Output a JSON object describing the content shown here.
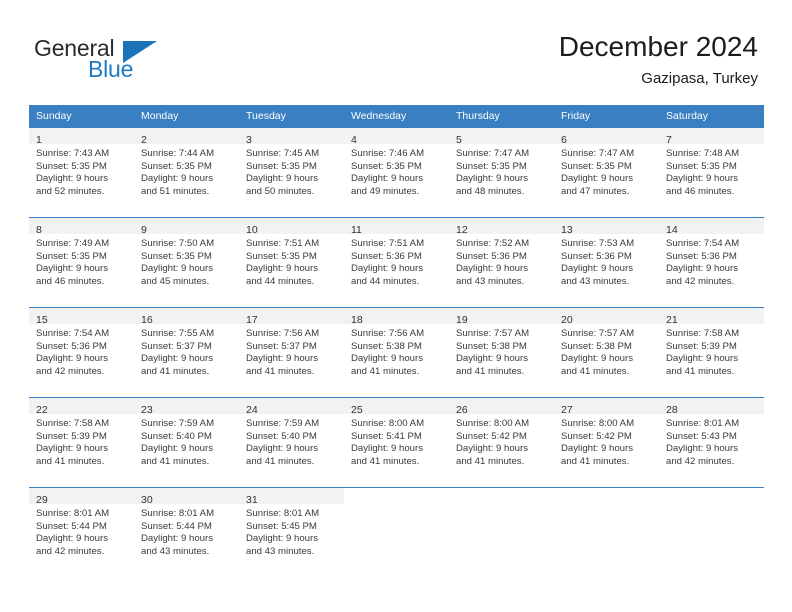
{
  "brand": {
    "name_top": "General",
    "name_bottom": "Blue",
    "triangle_icon": "triangle-icon",
    "accent_color": "#1a73b8"
  },
  "header": {
    "title": "December 2024",
    "subtitle": "Gazipasa, Turkey"
  },
  "theme": {
    "header_bg": "#3a7fc1",
    "daynum_band_bg": "#f2f2f2",
    "text_color": "#3a3a3a"
  },
  "weekdays": [
    "Sunday",
    "Monday",
    "Tuesday",
    "Wednesday",
    "Thursday",
    "Friday",
    "Saturday"
  ],
  "weeks": [
    [
      {
        "day": "1",
        "sunrise": "Sunrise: 7:43 AM",
        "sunset": "Sunset: 5:35 PM",
        "daylight_1": "Daylight: 9 hours",
        "daylight_2": "and 52 minutes."
      },
      {
        "day": "2",
        "sunrise": "Sunrise: 7:44 AM",
        "sunset": "Sunset: 5:35 PM",
        "daylight_1": "Daylight: 9 hours",
        "daylight_2": "and 51 minutes."
      },
      {
        "day": "3",
        "sunrise": "Sunrise: 7:45 AM",
        "sunset": "Sunset: 5:35 PM",
        "daylight_1": "Daylight: 9 hours",
        "daylight_2": "and 50 minutes."
      },
      {
        "day": "4",
        "sunrise": "Sunrise: 7:46 AM",
        "sunset": "Sunset: 5:35 PM",
        "daylight_1": "Daylight: 9 hours",
        "daylight_2": "and 49 minutes."
      },
      {
        "day": "5",
        "sunrise": "Sunrise: 7:47 AM",
        "sunset": "Sunset: 5:35 PM",
        "daylight_1": "Daylight: 9 hours",
        "daylight_2": "and 48 minutes."
      },
      {
        "day": "6",
        "sunrise": "Sunrise: 7:47 AM",
        "sunset": "Sunset: 5:35 PM",
        "daylight_1": "Daylight: 9 hours",
        "daylight_2": "and 47 minutes."
      },
      {
        "day": "7",
        "sunrise": "Sunrise: 7:48 AM",
        "sunset": "Sunset: 5:35 PM",
        "daylight_1": "Daylight: 9 hours",
        "daylight_2": "and 46 minutes."
      }
    ],
    [
      {
        "day": "8",
        "sunrise": "Sunrise: 7:49 AM",
        "sunset": "Sunset: 5:35 PM",
        "daylight_1": "Daylight: 9 hours",
        "daylight_2": "and 46 minutes."
      },
      {
        "day": "9",
        "sunrise": "Sunrise: 7:50 AM",
        "sunset": "Sunset: 5:35 PM",
        "daylight_1": "Daylight: 9 hours",
        "daylight_2": "and 45 minutes."
      },
      {
        "day": "10",
        "sunrise": "Sunrise: 7:51 AM",
        "sunset": "Sunset: 5:35 PM",
        "daylight_1": "Daylight: 9 hours",
        "daylight_2": "and 44 minutes."
      },
      {
        "day": "11",
        "sunrise": "Sunrise: 7:51 AM",
        "sunset": "Sunset: 5:36 PM",
        "daylight_1": "Daylight: 9 hours",
        "daylight_2": "and 44 minutes."
      },
      {
        "day": "12",
        "sunrise": "Sunrise: 7:52 AM",
        "sunset": "Sunset: 5:36 PM",
        "daylight_1": "Daylight: 9 hours",
        "daylight_2": "and 43 minutes."
      },
      {
        "day": "13",
        "sunrise": "Sunrise: 7:53 AM",
        "sunset": "Sunset: 5:36 PM",
        "daylight_1": "Daylight: 9 hours",
        "daylight_2": "and 43 minutes."
      },
      {
        "day": "14",
        "sunrise": "Sunrise: 7:54 AM",
        "sunset": "Sunset: 5:36 PM",
        "daylight_1": "Daylight: 9 hours",
        "daylight_2": "and 42 minutes."
      }
    ],
    [
      {
        "day": "15",
        "sunrise": "Sunrise: 7:54 AM",
        "sunset": "Sunset: 5:36 PM",
        "daylight_1": "Daylight: 9 hours",
        "daylight_2": "and 42 minutes."
      },
      {
        "day": "16",
        "sunrise": "Sunrise: 7:55 AM",
        "sunset": "Sunset: 5:37 PM",
        "daylight_1": "Daylight: 9 hours",
        "daylight_2": "and 41 minutes."
      },
      {
        "day": "17",
        "sunrise": "Sunrise: 7:56 AM",
        "sunset": "Sunset: 5:37 PM",
        "daylight_1": "Daylight: 9 hours",
        "daylight_2": "and 41 minutes."
      },
      {
        "day": "18",
        "sunrise": "Sunrise: 7:56 AM",
        "sunset": "Sunset: 5:38 PM",
        "daylight_1": "Daylight: 9 hours",
        "daylight_2": "and 41 minutes."
      },
      {
        "day": "19",
        "sunrise": "Sunrise: 7:57 AM",
        "sunset": "Sunset: 5:38 PM",
        "daylight_1": "Daylight: 9 hours",
        "daylight_2": "and 41 minutes."
      },
      {
        "day": "20",
        "sunrise": "Sunrise: 7:57 AM",
        "sunset": "Sunset: 5:38 PM",
        "daylight_1": "Daylight: 9 hours",
        "daylight_2": "and 41 minutes."
      },
      {
        "day": "21",
        "sunrise": "Sunrise: 7:58 AM",
        "sunset": "Sunset: 5:39 PM",
        "daylight_1": "Daylight: 9 hours",
        "daylight_2": "and 41 minutes."
      }
    ],
    [
      {
        "day": "22",
        "sunrise": "Sunrise: 7:58 AM",
        "sunset": "Sunset: 5:39 PM",
        "daylight_1": "Daylight: 9 hours",
        "daylight_2": "and 41 minutes."
      },
      {
        "day": "23",
        "sunrise": "Sunrise: 7:59 AM",
        "sunset": "Sunset: 5:40 PM",
        "daylight_1": "Daylight: 9 hours",
        "daylight_2": "and 41 minutes."
      },
      {
        "day": "24",
        "sunrise": "Sunrise: 7:59 AM",
        "sunset": "Sunset: 5:40 PM",
        "daylight_1": "Daylight: 9 hours",
        "daylight_2": "and 41 minutes."
      },
      {
        "day": "25",
        "sunrise": "Sunrise: 8:00 AM",
        "sunset": "Sunset: 5:41 PM",
        "daylight_1": "Daylight: 9 hours",
        "daylight_2": "and 41 minutes."
      },
      {
        "day": "26",
        "sunrise": "Sunrise: 8:00 AM",
        "sunset": "Sunset: 5:42 PM",
        "daylight_1": "Daylight: 9 hours",
        "daylight_2": "and 41 minutes."
      },
      {
        "day": "27",
        "sunrise": "Sunrise: 8:00 AM",
        "sunset": "Sunset: 5:42 PM",
        "daylight_1": "Daylight: 9 hours",
        "daylight_2": "and 41 minutes."
      },
      {
        "day": "28",
        "sunrise": "Sunrise: 8:01 AM",
        "sunset": "Sunset: 5:43 PM",
        "daylight_1": "Daylight: 9 hours",
        "daylight_2": "and 42 minutes."
      }
    ],
    [
      {
        "day": "29",
        "sunrise": "Sunrise: 8:01 AM",
        "sunset": "Sunset: 5:44 PM",
        "daylight_1": "Daylight: 9 hours",
        "daylight_2": "and 42 minutes."
      },
      {
        "day": "30",
        "sunrise": "Sunrise: 8:01 AM",
        "sunset": "Sunset: 5:44 PM",
        "daylight_1": "Daylight: 9 hours",
        "daylight_2": "and 43 minutes."
      },
      {
        "day": "31",
        "sunrise": "Sunrise: 8:01 AM",
        "sunset": "Sunset: 5:45 PM",
        "daylight_1": "Daylight: 9 hours",
        "daylight_2": "and 43 minutes."
      },
      null,
      null,
      null,
      null
    ]
  ]
}
